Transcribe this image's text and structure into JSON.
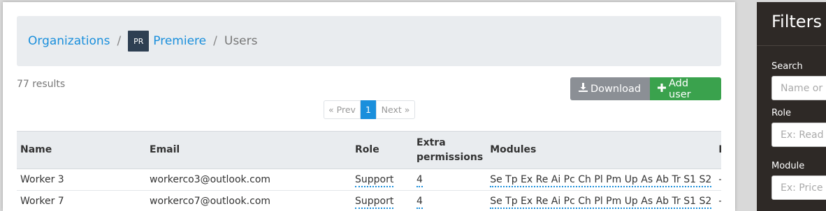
{
  "breadcrumb": {
    "organizations": "Organizations",
    "org_initials": "PR",
    "org_name": "Premiere",
    "current": "Users",
    "separator": "/"
  },
  "results_text": "77 results",
  "buttons": {
    "download": "Download",
    "add_user": "Add user"
  },
  "pagination": {
    "prev": "« Prev",
    "current_page": "1",
    "next": "Next »"
  },
  "table": {
    "headers": [
      "Name",
      "Email",
      "Role",
      "Extra permissions",
      "Modules",
      "Re"
    ],
    "rows": [
      {
        "name": "Worker 3",
        "email": "workerco3@outlook.com",
        "role": "Support",
        "extra": "4",
        "modules": "Se Tp Ex Re Ai Pc Ch Pl Pm Up As Ab Tr S1 S2",
        "re": "-"
      },
      {
        "name": "Worker 7",
        "email": "workerco7@outlook.com",
        "role": "Support",
        "extra": "4",
        "modules": "Se Tp Ex Re Ai Pc Ch Pl Pm Up As Ab Tr S1 S2",
        "re": "-"
      }
    ]
  },
  "filters": {
    "title": "Filters",
    "search_label": "Search",
    "search_placeholder": "Name or",
    "role_label": "Role",
    "role_placeholder": "Ex: Read o",
    "module_label": "Module",
    "module_placeholder": "Ex: Price c"
  },
  "colors": {
    "accent": "#1a8fdc",
    "success": "#3aa24d",
    "secondary": "#8b8f95",
    "sidebar": "#2e2926"
  }
}
